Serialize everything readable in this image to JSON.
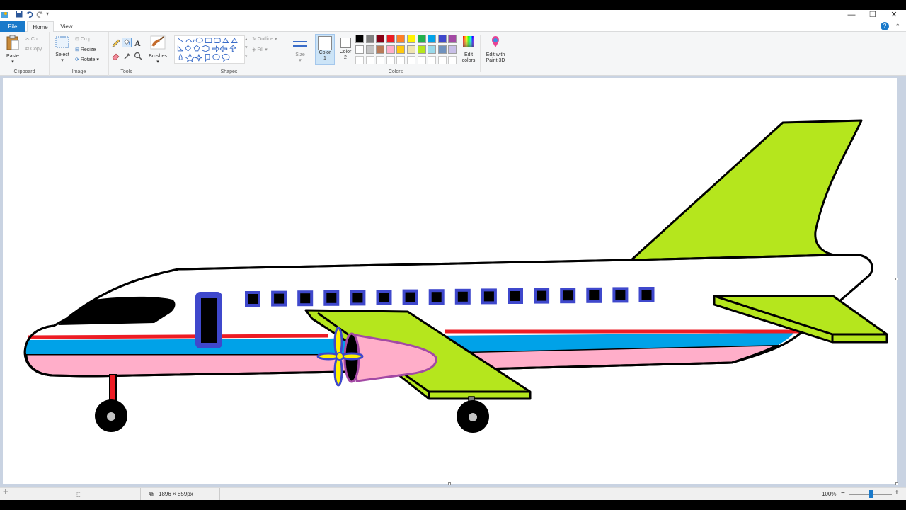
{
  "window": {
    "minimize": "—",
    "restore": "❐",
    "close": "✕"
  },
  "tabs": {
    "file": "File",
    "home": "Home",
    "view": "View"
  },
  "ribbon": {
    "clipboard": {
      "paste": "Paste",
      "cut": "Cut",
      "copy": "Copy",
      "label": "Clipboard"
    },
    "image": {
      "select": "Select",
      "crop": "Crop",
      "resize": "Resize",
      "rotate": "Rotate",
      "label": "Image"
    },
    "tools": {
      "label": "Tools"
    },
    "brushes": {
      "label": "Brushes"
    },
    "shapes": {
      "outline": "Outline",
      "fill": "Fill",
      "label": "Shapes"
    },
    "size": {
      "label": "Size"
    },
    "color1": {
      "line1": "Color",
      "line2": "1"
    },
    "color2": {
      "line1": "Color",
      "line2": "2"
    },
    "colors": {
      "label": "Colors",
      "row1": [
        "#000000",
        "#7f7f7f",
        "#880015",
        "#ed1c24",
        "#ff7f27",
        "#fff200",
        "#22b14c",
        "#00a2e8",
        "#3f48cc",
        "#a349a4"
      ],
      "row2": [
        "#ffffff",
        "#c3c3c3",
        "#b97a57",
        "#ffaec9",
        "#ffc90e",
        "#efe4b0",
        "#b5e61d",
        "#99d9ea",
        "#7092be",
        "#c8bfe7"
      ]
    },
    "edit_colors": {
      "line1": "Edit",
      "line2": "colors"
    },
    "paint3d": {
      "line1": "Edit with",
      "line2": "Paint 3D"
    }
  },
  "status": {
    "dimensions": "1896 × 859px",
    "zoom": "100%"
  },
  "icons": [
    "save-icon",
    "undo-icon",
    "redo-icon",
    "paste-icon",
    "select-icon",
    "pencil-icon",
    "fill-icon",
    "text-icon",
    "eraser-icon",
    "picker-icon",
    "magnifier-icon",
    "brush-icon",
    "edit-colors-icon",
    "paint3d-icon"
  ],
  "drawing": {
    "body_color": "#ffffff",
    "belly_color": "#ffaec9",
    "stripe_blue": "#00a2e8",
    "stripe_red": "#ed1c24",
    "wing_color": "#b5e61d",
    "window_frame": "#3f48cc",
    "window_count": 16
  }
}
